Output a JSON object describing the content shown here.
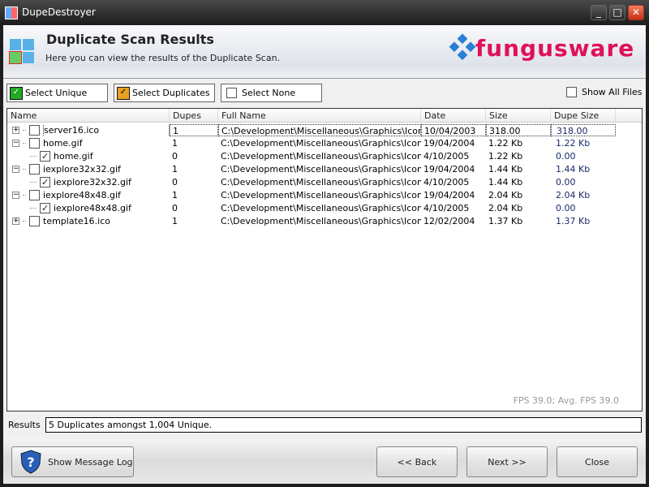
{
  "window": {
    "title": "DupeDestroyer",
    "minimize": "_",
    "maximize": "□",
    "close": "✕"
  },
  "header": {
    "title": "Duplicate Scan Results",
    "subtitle": "Here you can view the results of the Duplicate Scan.",
    "logo_text": "fungusware"
  },
  "toolbar": {
    "select_unique": "Select Unique",
    "select_duplicates": "Select Duplicates",
    "select_none": "Select None",
    "show_all_files": "Show All Files"
  },
  "columns": [
    "Name",
    "Dupes",
    "Full Name",
    "Date",
    "Size",
    "Dupe Size"
  ],
  "rows": [
    {
      "name": "server16.ico",
      "dupes": "1",
      "full": "C:\\Development\\Miscellaneous\\Graphics\\Icons ...",
      "date": "10/04/2003",
      "size": "318.00",
      "dupe_size": "318.00",
      "level": 0,
      "exp": "+",
      "checked": false
    },
    {
      "name": "home.gif",
      "dupes": "1",
      "full": "C:\\Development\\Miscellaneous\\Graphics\\Icons ...",
      "date": "19/04/2004",
      "size": "1.22 Kb",
      "dupe_size": "1.22 Kb",
      "level": 0,
      "exp": "−",
      "checked": false
    },
    {
      "name": "home.gif",
      "dupes": "0",
      "full": "C:\\Development\\Miscellaneous\\Graphics\\Icons ...",
      "date": "4/10/2005",
      "size": "1.22 Kb",
      "dupe_size": "0.00",
      "level": 1,
      "checked": true
    },
    {
      "name": "iexplore32x32.gif",
      "dupes": "1",
      "full": "C:\\Development\\Miscellaneous\\Graphics\\Icons ...",
      "date": "19/04/2004",
      "size": "1.44 Kb",
      "dupe_size": "1.44 Kb",
      "level": 0,
      "exp": "−",
      "checked": false
    },
    {
      "name": "iexplore32x32.gif",
      "dupes": "0",
      "full": "C:\\Development\\Miscellaneous\\Graphics\\Icons ...",
      "date": "4/10/2005",
      "size": "1.44 Kb",
      "dupe_size": "0.00",
      "level": 1,
      "checked": true
    },
    {
      "name": "iexplore48x48.gif",
      "dupes": "1",
      "full": "C:\\Development\\Miscellaneous\\Graphics\\Icons ...",
      "date": "19/04/2004",
      "size": "2.04 Kb",
      "dupe_size": "2.04 Kb",
      "level": 0,
      "exp": "−",
      "checked": false
    },
    {
      "name": "iexplore48x48.gif",
      "dupes": "0",
      "full": "C:\\Development\\Miscellaneous\\Graphics\\Icons ...",
      "date": "4/10/2005",
      "size": "2.04 Kb",
      "dupe_size": "0.00",
      "level": 1,
      "checked": true
    },
    {
      "name": "template16.ico",
      "dupes": "1",
      "full": "C:\\Development\\Miscellaneous\\Graphics\\Icons ...",
      "date": "12/02/2004",
      "size": "1.37 Kb",
      "dupe_size": "1.37 Kb",
      "level": 0,
      "exp": "+",
      "checked": false
    }
  ],
  "fps": "FPS 39.0; Avg. FPS 39.0",
  "results": {
    "label": "Results",
    "value": "5 Duplicates amongst 1,004 Unique."
  },
  "footer": {
    "message_log": "Show Message Log",
    "back": "<< Back",
    "next": "Next >>",
    "close": "Close"
  },
  "colors": {
    "logo": "#e0105a",
    "dupe_size_text": "#1a2a6a"
  }
}
